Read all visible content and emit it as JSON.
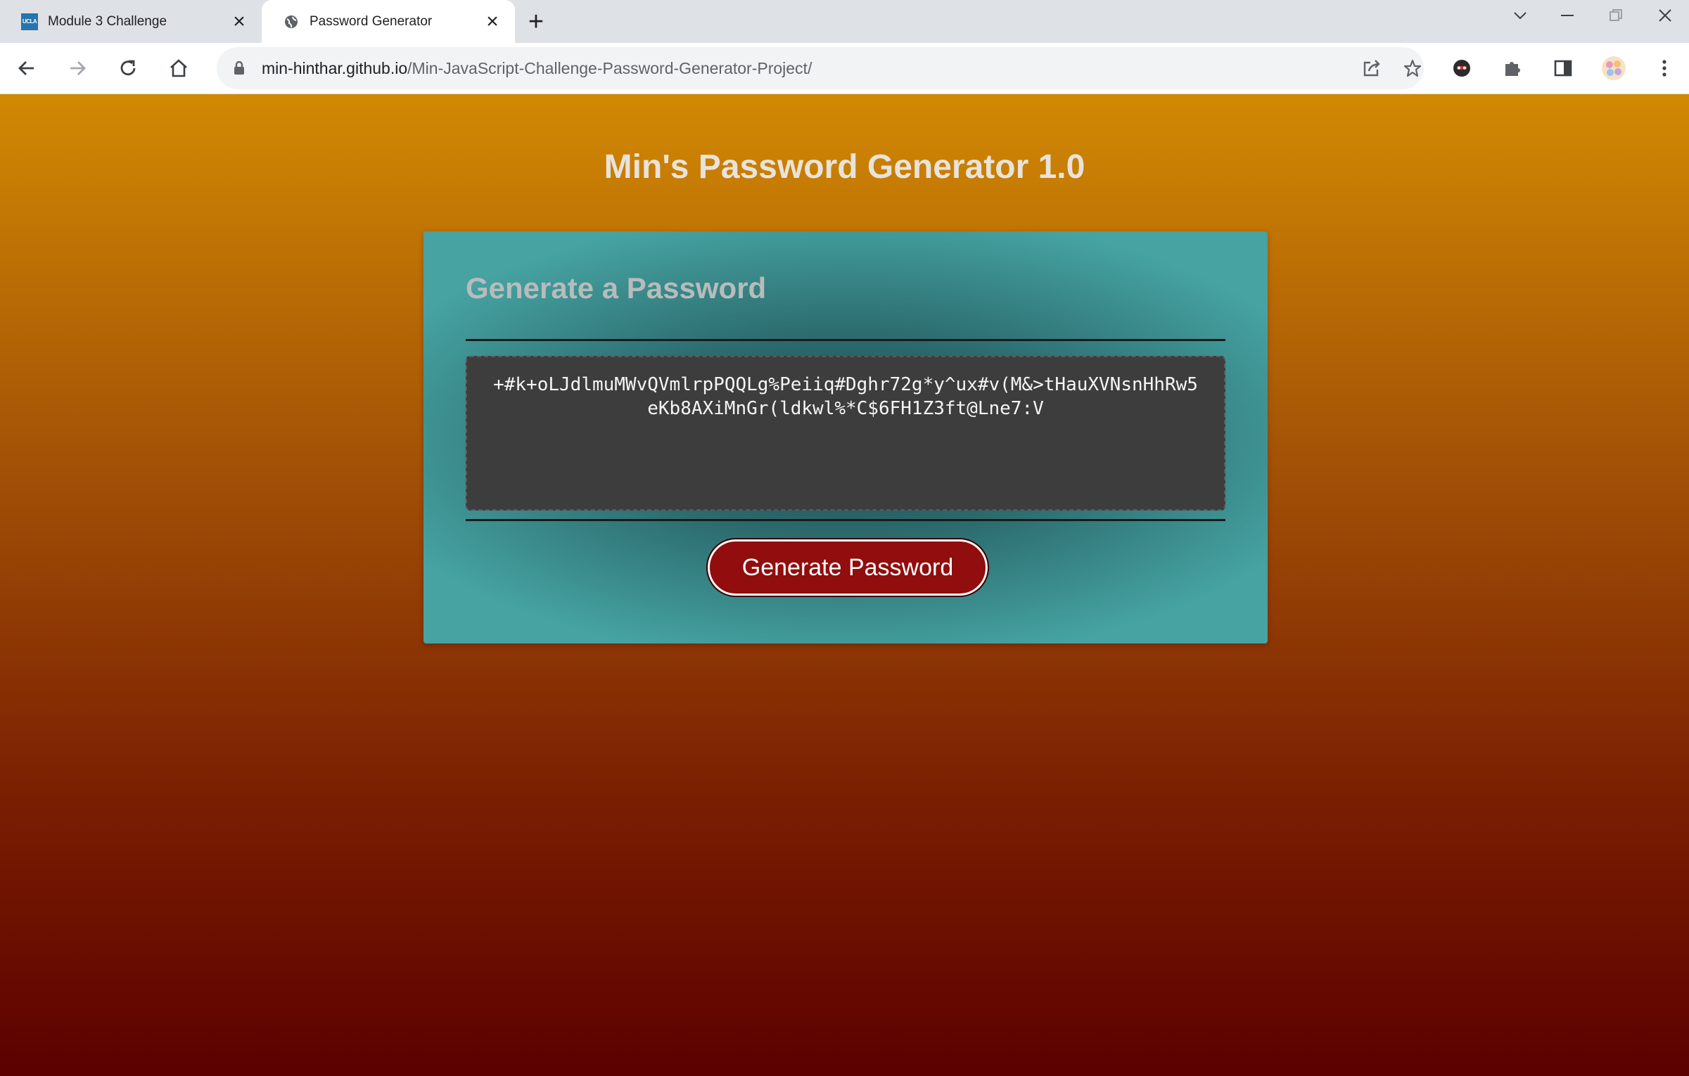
{
  "browser": {
    "tabs": [
      {
        "title": "Module 3 Challenge",
        "favicon": "ucla-icon",
        "favicon_text": "UCLA",
        "active": false
      },
      {
        "title": "Password Generator",
        "favicon": "globe-icon",
        "active": true
      }
    ],
    "url": {
      "host": "min-hinthar.github.io",
      "path": "/Min-JavaScript-Challenge-Password-Generator-Project/"
    }
  },
  "page": {
    "title": "Min's Password Generator 1.0",
    "card": {
      "header": "Generate a Password",
      "password": "+#k+oLJdlmuMWvQVmlrpPQQLg%Peiiq#Dghr72g*y^ux#v(M&>tHauXVNsnHhRw5eKb8AXiMnGr(ldkwl%*C$6FH1Z3ft@Lne7:V",
      "button_label": "Generate Password"
    }
  },
  "colors": {
    "button": "#920d0d",
    "card_edge": "#46a3a2",
    "bg_top": "#d28903",
    "bg_bottom": "#5c0000"
  }
}
